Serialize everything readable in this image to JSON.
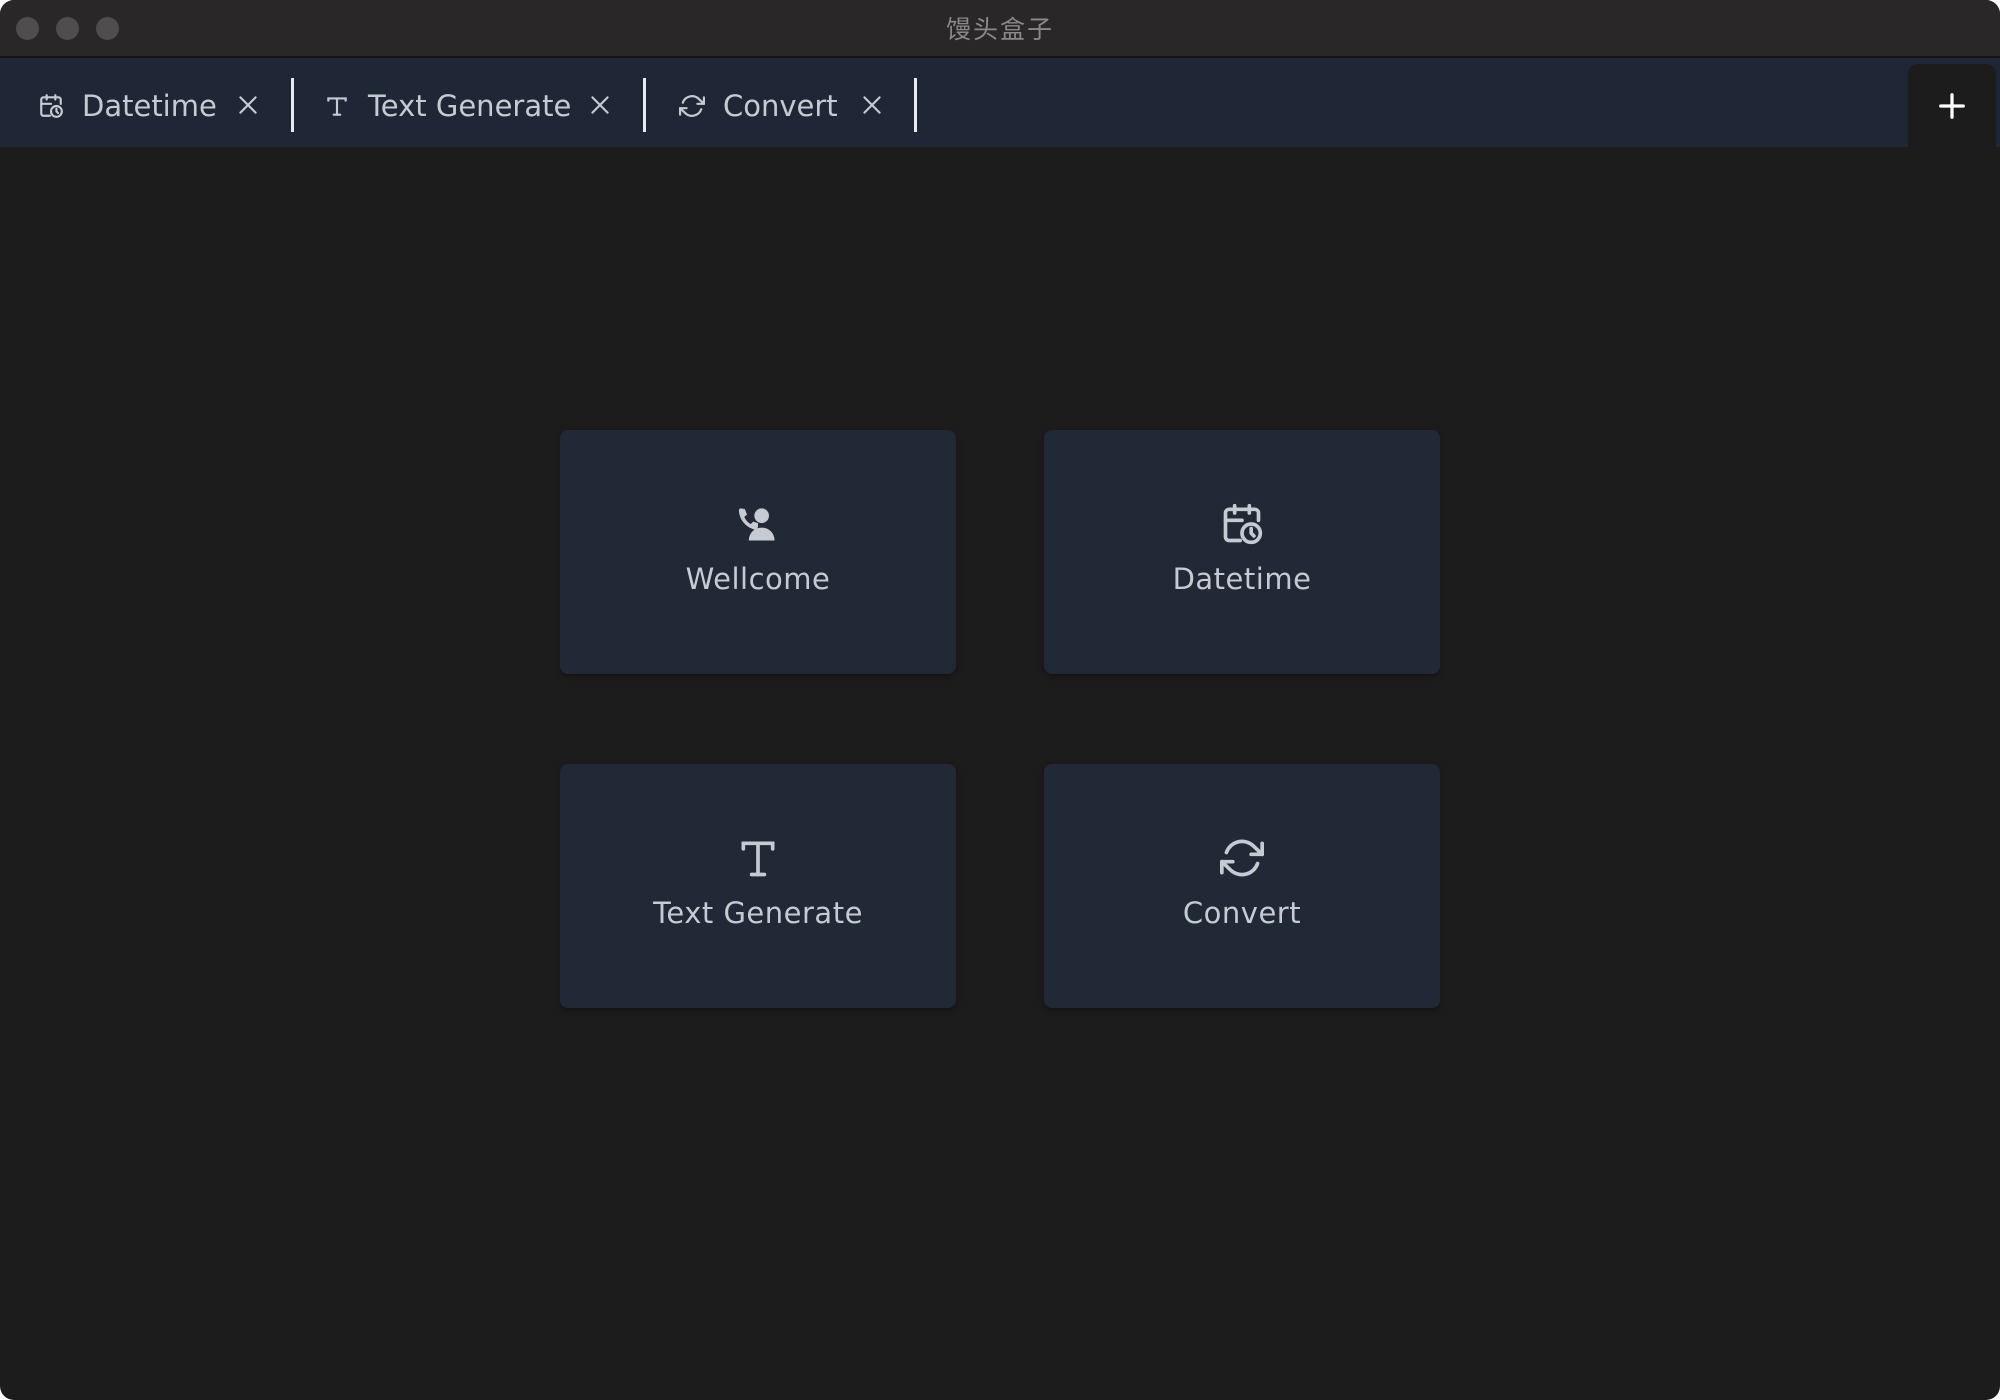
{
  "window": {
    "title": "馒头盒子"
  },
  "tabs": [
    {
      "label": "Datetime",
      "icon": "calendar-clock-icon"
    },
    {
      "label": "Text Generate",
      "icon": "text-icon"
    },
    {
      "label": "Convert",
      "icon": "refresh-icon"
    }
  ],
  "add_tab": {
    "icon": "plus-icon"
  },
  "cards": [
    {
      "label": "Wellcome",
      "icon": "user-welcome-icon"
    },
    {
      "label": "Datetime",
      "icon": "calendar-clock-icon"
    },
    {
      "label": "Text Generate",
      "icon": "text-icon"
    },
    {
      "label": "Convert",
      "icon": "refresh-icon"
    }
  ],
  "colors": {
    "background": "#1c1c1c",
    "tabbar": "#1f2736",
    "card": "#212836",
    "text": "#c6cad2",
    "titlebar": "#292727"
  }
}
